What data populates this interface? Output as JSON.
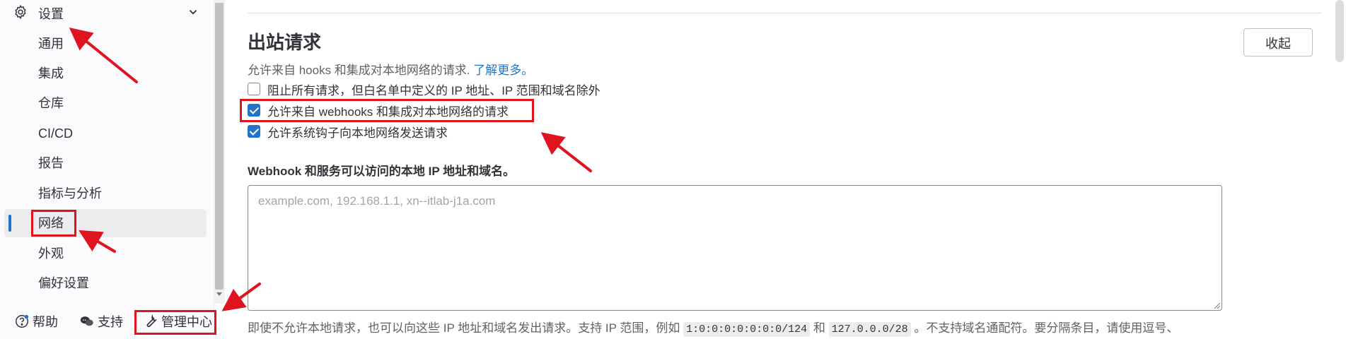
{
  "sidebar": {
    "header_title": "设置",
    "items": [
      {
        "label": "通用"
      },
      {
        "label": "集成"
      },
      {
        "label": "仓库"
      },
      {
        "label": "CI/CD"
      },
      {
        "label": "报告"
      },
      {
        "label": "指标与分析"
      },
      {
        "label": "网络",
        "active": true
      },
      {
        "label": "外观"
      },
      {
        "label": "偏好设置"
      }
    ],
    "footer": {
      "help_label": "帮助",
      "support_label": "支持",
      "admin_label": "管理中心"
    }
  },
  "main": {
    "section_title": "出站请求",
    "collapse_label": "收起",
    "description": "允许来自 hooks 和集成对本地网络的请求.",
    "learn_more": "了解更多。",
    "checkboxes": [
      {
        "label": "阻止所有请求，但白名单中定义的 IP 地址、IP 范围和域名除外",
        "checked": false
      },
      {
        "label": "允许来自 webhooks 和集成对本地网络的请求",
        "checked": true
      },
      {
        "label": "允许系统钩子向本地网络发送请求",
        "checked": true
      }
    ],
    "field_label": "Webhook 和服务可以访问的本地 IP 地址和域名。",
    "textarea_placeholder": "example.com, 192.168.1.1, xn--itlab-j1a.com",
    "help_text": {
      "part1": "即使不允许本地请求，也可以向这些 IP 地址和域名发出请求。支持 IP 范围，例如",
      "code1": "1:0:0:0:0:0:0:0/124",
      "part2": "和",
      "code2": "127.0.0.0/28",
      "part3": "。不支持域名通配符。要分隔条目，请使用逗号、"
    }
  },
  "colors": {
    "accent": "#1f75cb",
    "annotation": "#e0141e"
  }
}
